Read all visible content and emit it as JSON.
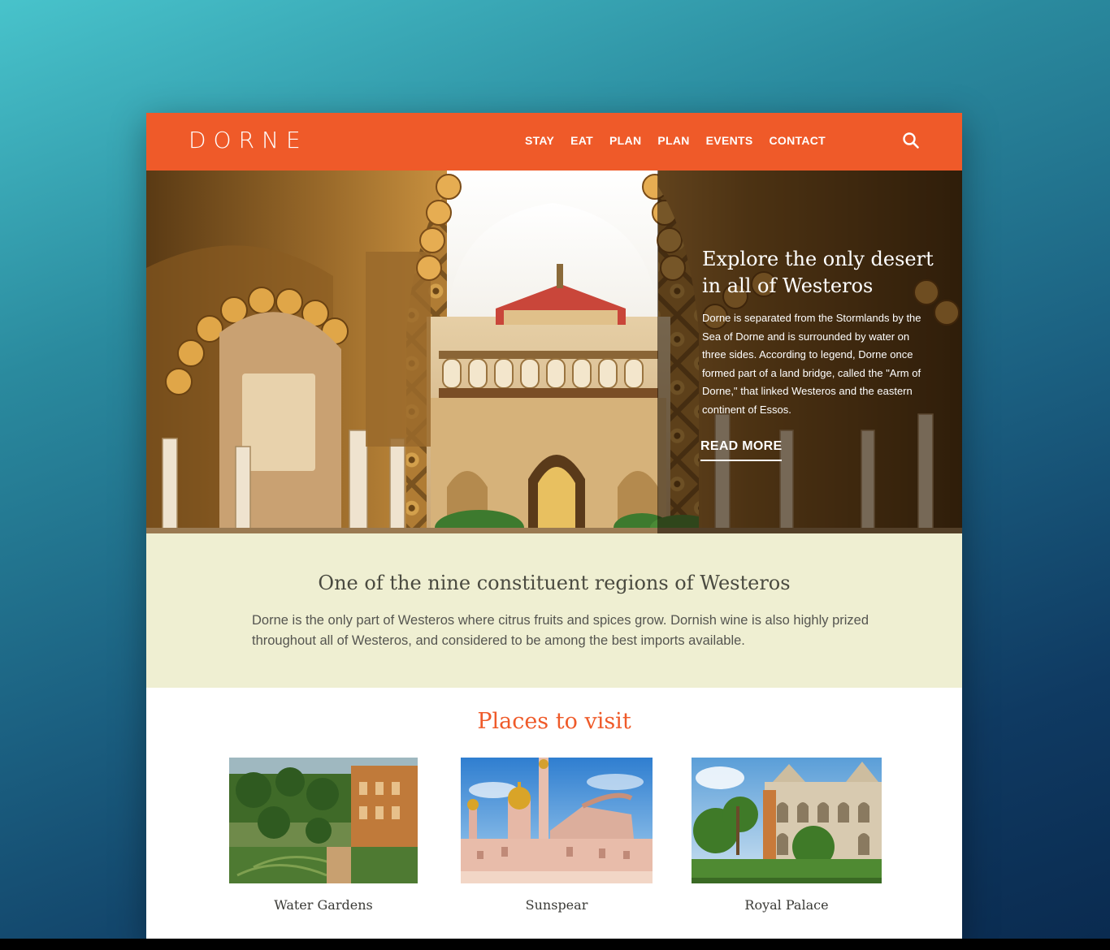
{
  "site": {
    "logo": "DORNE",
    "nav": [
      "STAY",
      "EAT",
      "PLAN",
      "PLAN",
      "EVENTS",
      "CONTACT"
    ],
    "search_icon": "search-icon",
    "accent_color": "#ef5a29"
  },
  "hero": {
    "title": "Explore the only desert in all of Westeros",
    "text": "Dorne is separated from the Stormlands by the Sea of Dorne and is surrounded by water on three sides. According to legend, Dorne once formed part of a land bridge, called the \"Arm of Dorne,\" that linked Westeros and the eastern continent of Essos.",
    "cta": "READ MORE"
  },
  "intro": {
    "title": "One of the nine constituent regions of Westeros",
    "text": "Dorne is the only part of Westeros where citrus fruits and spices grow. Dornish wine is also highly prized throughout all of Westeros, and considered to be among the best imports available.",
    "background_color": "#efefd2"
  },
  "places": {
    "title": "Places to visit",
    "items": [
      {
        "label": "Water Gardens"
      },
      {
        "label": "Sunspear"
      },
      {
        "label": "Royal Palace"
      }
    ]
  }
}
